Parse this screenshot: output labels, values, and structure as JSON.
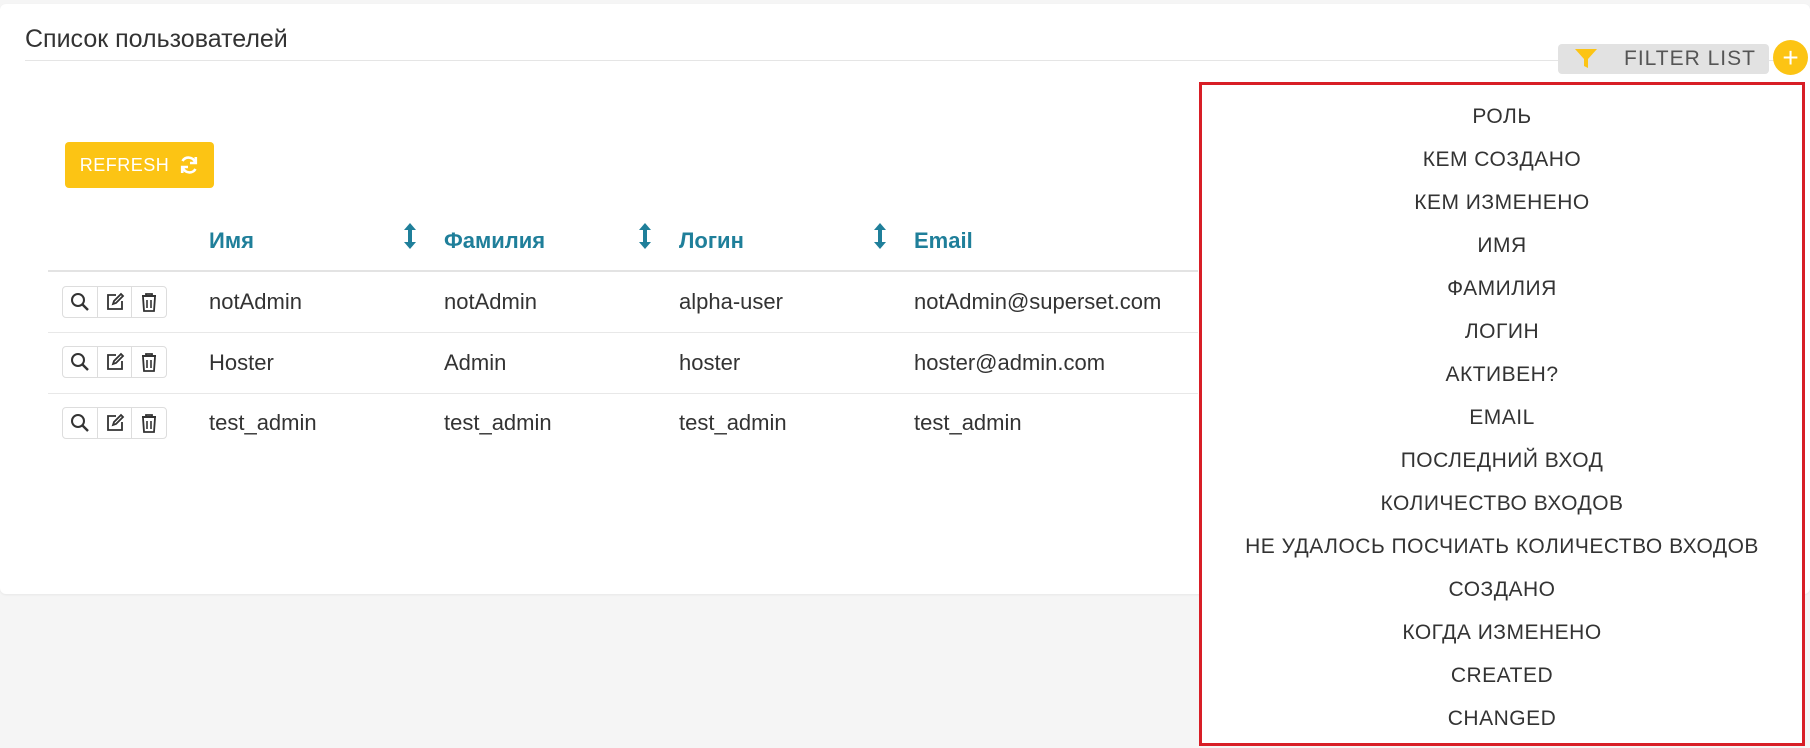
{
  "page": {
    "title": "Список пользователей"
  },
  "toolbar": {
    "filter_label": "FILTER LIST",
    "add_label": "+",
    "refresh_label": "REFRESH"
  },
  "table": {
    "columns": [
      "Имя",
      "Фамилия",
      "Логин",
      "Email"
    ],
    "rows": [
      [
        "notAdmin",
        "notAdmin",
        "alpha-user",
        "notAdmin@superset.com"
      ],
      [
        "Hoster",
        "Admin",
        "hoster",
        "hoster@admin.com"
      ],
      [
        "test_admin",
        "test_admin",
        "test_admin",
        "test_admin"
      ]
    ]
  },
  "filter_menu": {
    "items": [
      "РОЛЬ",
      "КЕМ СОЗДАНО",
      "КЕМ ИЗМЕНЕНО",
      "ИМЯ",
      "ФАМИЛИЯ",
      "ЛОГИН",
      "АКТИВЕН?",
      "EMAIL",
      "ПОСЛЕДНИЙ ВХОД",
      "КОЛИЧЕСТВО ВХОДОВ",
      "НЕ УДАЛОСЬ ПОСЧИАТЬ КОЛИЧЕСТВО ВХОДОВ",
      "СОЗДАНО",
      "КОГДА ИЗМЕНЕНО",
      "CREATED",
      "CHANGED"
    ]
  },
  "colors": {
    "accent": "#fcc414",
    "header_text": "#1f7f9a",
    "highlight_border": "#d81e26"
  }
}
